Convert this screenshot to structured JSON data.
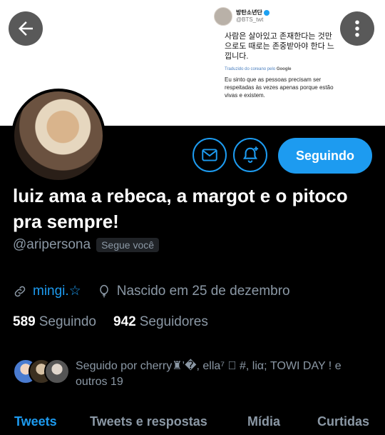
{
  "banner": {
    "tweet": {
      "author_name": "방탄소년단",
      "author_handle": "@BTS_twt",
      "text": "사람은 살아있고 존재한다는 것만으로도 때로는 존중받아야 한다 느낍니다.",
      "translated_label": "Traduzido do coreano pelo",
      "translated_by": "Google",
      "translation": "Eu sinto que as pessoas precisam ser respeitadas às vezes apenas porque estão vivas e existem."
    }
  },
  "nav": {
    "back_icon": "arrow-left-icon",
    "more_icon": "more-vertical-icon"
  },
  "actions": {
    "message_icon": "envelope-icon",
    "notify_icon": "bell-plus-icon",
    "follow_label": "Seguindo"
  },
  "profile": {
    "display_name": "luiz ama a rebeca, a margot e o pitoco pra sempre!",
    "handle": "@aripersona",
    "follows_you": "Segue você",
    "link": "mingi.☆",
    "birthday": "Nascido em 25 de dezembro",
    "following_count": "589",
    "following_label": "Seguindo",
    "followers_count": "942",
    "followers_label": "Seguidores",
    "followed_by": "Seguido por cherry♜’�, ella⁷ ⃝ #, liα; TOWI DAY ! e outros 19"
  },
  "tabs": [
    "Tweets",
    "Tweets e respostas",
    "Mídia",
    "Curtidas"
  ],
  "colors": {
    "accent": "#1d9bf0",
    "background": "#000000",
    "secondary_text": "#8b98a5"
  }
}
